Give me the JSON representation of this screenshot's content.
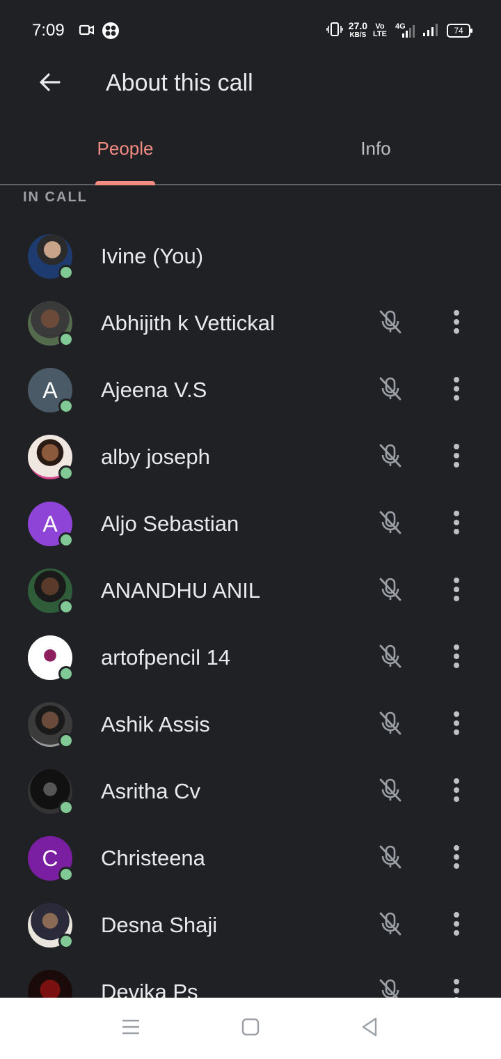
{
  "status_bar": {
    "time": "7:09",
    "icons": [
      "video-camera-icon",
      "app-icon"
    ],
    "net_speed": "27.0",
    "net_unit": "KB/S",
    "volte_top": "Vo",
    "volte_bottom": "LTE",
    "network": "4G",
    "battery": "74"
  },
  "header": {
    "title": "About this call",
    "back_icon": "arrow-back-icon"
  },
  "tabs": [
    {
      "label": "People",
      "selected": true
    },
    {
      "label": "Info",
      "selected": false
    }
  ],
  "section_label": "IN CALL",
  "colors": {
    "background": "#202124",
    "accent": "#f28b82",
    "presence": "#81c995"
  },
  "participants": [
    {
      "name": "Ivine (You)",
      "avatar": "photo",
      "initial": "",
      "muted": false,
      "online": true
    },
    {
      "name": "Abhijith k Vettickal",
      "avatar": "photo",
      "initial": "",
      "muted": true,
      "online": true
    },
    {
      "name": "Ajeena V.S",
      "avatar": "initial",
      "initial": "A",
      "avatar_color": "#4a5a66",
      "muted": true,
      "online": true
    },
    {
      "name": "alby joseph",
      "avatar": "photo",
      "initial": "",
      "muted": true,
      "online": true
    },
    {
      "name": "Aljo Sebastian",
      "avatar": "initial",
      "initial": "A",
      "avatar_color": "#8e44d6",
      "muted": true,
      "online": true
    },
    {
      "name": "ANANDHU ANIL",
      "avatar": "photo",
      "initial": "",
      "muted": true,
      "online": true
    },
    {
      "name": "artofpencil 14",
      "avatar": "photo",
      "initial": "",
      "muted": true,
      "online": true
    },
    {
      "name": "Ashik Assis",
      "avatar": "photo",
      "initial": "",
      "muted": true,
      "online": true
    },
    {
      "name": "Asritha Cv",
      "avatar": "photo",
      "initial": "",
      "muted": true,
      "online": true
    },
    {
      "name": "Christeena",
      "avatar": "initial",
      "initial": "C",
      "avatar_color": "#7b1fa2",
      "muted": true,
      "online": true
    },
    {
      "name": "Desna Shaji",
      "avatar": "photo",
      "initial": "",
      "muted": true,
      "online": true
    },
    {
      "name": "Devika Ps",
      "avatar": "photo",
      "initial": "",
      "muted": true,
      "online": true
    }
  ],
  "nav_bar": {
    "buttons": [
      "menu-icon",
      "home-icon",
      "back-triangle-icon"
    ]
  }
}
